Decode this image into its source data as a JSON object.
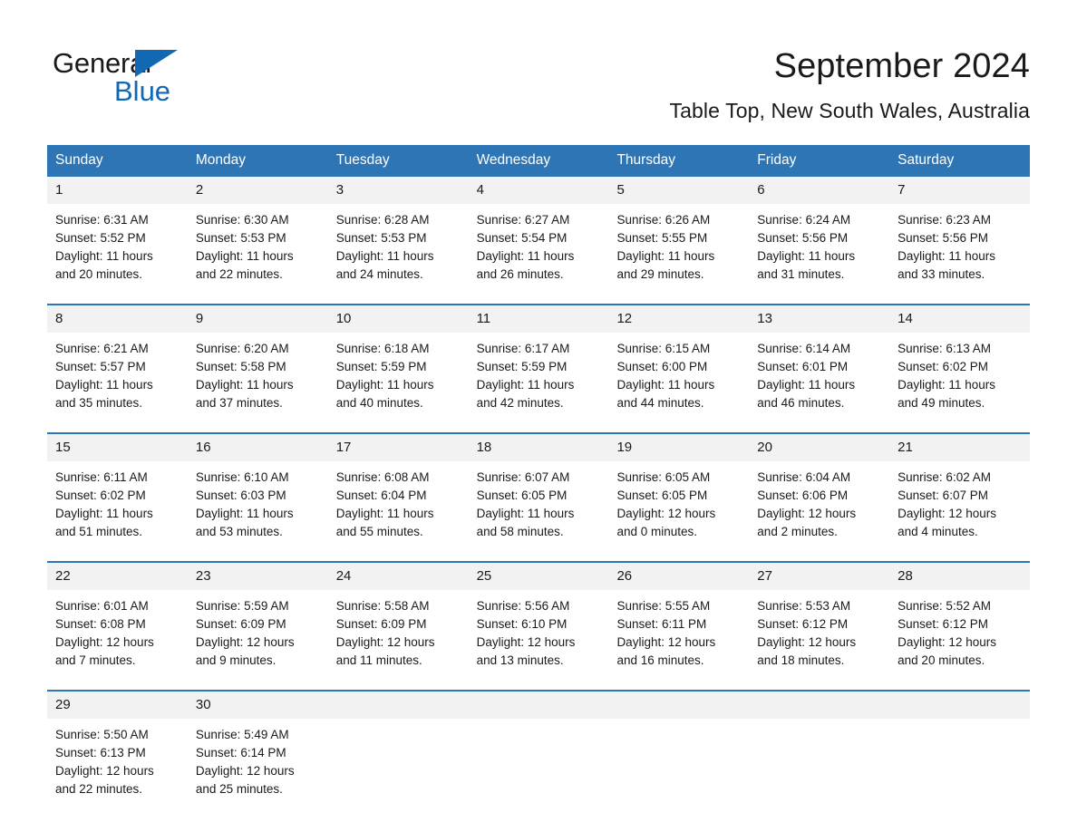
{
  "brand": {
    "name_part1": "General",
    "name_part2": "Blue",
    "accent_color": "#1268b3"
  },
  "header": {
    "month_title": "September 2024",
    "location": "Table Top, New South Wales, Australia"
  },
  "theme": {
    "header_blue": "#2e75b6",
    "date_band": "#f2f2f2",
    "text": "#1a1a1a"
  },
  "weekday_headers": [
    "Sunday",
    "Monday",
    "Tuesday",
    "Wednesday",
    "Thursday",
    "Friday",
    "Saturday"
  ],
  "weeks": [
    [
      {
        "date": "1",
        "sunrise": "Sunrise: 6:31 AM",
        "sunset": "Sunset: 5:52 PM",
        "daylight_line1": "Daylight: 11 hours",
        "daylight_line2": "and 20 minutes."
      },
      {
        "date": "2",
        "sunrise": "Sunrise: 6:30 AM",
        "sunset": "Sunset: 5:53 PM",
        "daylight_line1": "Daylight: 11 hours",
        "daylight_line2": "and 22 minutes."
      },
      {
        "date": "3",
        "sunrise": "Sunrise: 6:28 AM",
        "sunset": "Sunset: 5:53 PM",
        "daylight_line1": "Daylight: 11 hours",
        "daylight_line2": "and 24 minutes."
      },
      {
        "date": "4",
        "sunrise": "Sunrise: 6:27 AM",
        "sunset": "Sunset: 5:54 PM",
        "daylight_line1": "Daylight: 11 hours",
        "daylight_line2": "and 26 minutes."
      },
      {
        "date": "5",
        "sunrise": "Sunrise: 6:26 AM",
        "sunset": "Sunset: 5:55 PM",
        "daylight_line1": "Daylight: 11 hours",
        "daylight_line2": "and 29 minutes."
      },
      {
        "date": "6",
        "sunrise": "Sunrise: 6:24 AM",
        "sunset": "Sunset: 5:56 PM",
        "daylight_line1": "Daylight: 11 hours",
        "daylight_line2": "and 31 minutes."
      },
      {
        "date": "7",
        "sunrise": "Sunrise: 6:23 AM",
        "sunset": "Sunset: 5:56 PM",
        "daylight_line1": "Daylight: 11 hours",
        "daylight_line2": "and 33 minutes."
      }
    ],
    [
      {
        "date": "8",
        "sunrise": "Sunrise: 6:21 AM",
        "sunset": "Sunset: 5:57 PM",
        "daylight_line1": "Daylight: 11 hours",
        "daylight_line2": "and 35 minutes."
      },
      {
        "date": "9",
        "sunrise": "Sunrise: 6:20 AM",
        "sunset": "Sunset: 5:58 PM",
        "daylight_line1": "Daylight: 11 hours",
        "daylight_line2": "and 37 minutes."
      },
      {
        "date": "10",
        "sunrise": "Sunrise: 6:18 AM",
        "sunset": "Sunset: 5:59 PM",
        "daylight_line1": "Daylight: 11 hours",
        "daylight_line2": "and 40 minutes."
      },
      {
        "date": "11",
        "sunrise": "Sunrise: 6:17 AM",
        "sunset": "Sunset: 5:59 PM",
        "daylight_line1": "Daylight: 11 hours",
        "daylight_line2": "and 42 minutes."
      },
      {
        "date": "12",
        "sunrise": "Sunrise: 6:15 AM",
        "sunset": "Sunset: 6:00 PM",
        "daylight_line1": "Daylight: 11 hours",
        "daylight_line2": "and 44 minutes."
      },
      {
        "date": "13",
        "sunrise": "Sunrise: 6:14 AM",
        "sunset": "Sunset: 6:01 PM",
        "daylight_line1": "Daylight: 11 hours",
        "daylight_line2": "and 46 minutes."
      },
      {
        "date": "14",
        "sunrise": "Sunrise: 6:13 AM",
        "sunset": "Sunset: 6:02 PM",
        "daylight_line1": "Daylight: 11 hours",
        "daylight_line2": "and 49 minutes."
      }
    ],
    [
      {
        "date": "15",
        "sunrise": "Sunrise: 6:11 AM",
        "sunset": "Sunset: 6:02 PM",
        "daylight_line1": "Daylight: 11 hours",
        "daylight_line2": "and 51 minutes."
      },
      {
        "date": "16",
        "sunrise": "Sunrise: 6:10 AM",
        "sunset": "Sunset: 6:03 PM",
        "daylight_line1": "Daylight: 11 hours",
        "daylight_line2": "and 53 minutes."
      },
      {
        "date": "17",
        "sunrise": "Sunrise: 6:08 AM",
        "sunset": "Sunset: 6:04 PM",
        "daylight_line1": "Daylight: 11 hours",
        "daylight_line2": "and 55 minutes."
      },
      {
        "date": "18",
        "sunrise": "Sunrise: 6:07 AM",
        "sunset": "Sunset: 6:05 PM",
        "daylight_line1": "Daylight: 11 hours",
        "daylight_line2": "and 58 minutes."
      },
      {
        "date": "19",
        "sunrise": "Sunrise: 6:05 AM",
        "sunset": "Sunset: 6:05 PM",
        "daylight_line1": "Daylight: 12 hours",
        "daylight_line2": "and 0 minutes."
      },
      {
        "date": "20",
        "sunrise": "Sunrise: 6:04 AM",
        "sunset": "Sunset: 6:06 PM",
        "daylight_line1": "Daylight: 12 hours",
        "daylight_line2": "and 2 minutes."
      },
      {
        "date": "21",
        "sunrise": "Sunrise: 6:02 AM",
        "sunset": "Sunset: 6:07 PM",
        "daylight_line1": "Daylight: 12 hours",
        "daylight_line2": "and 4 minutes."
      }
    ],
    [
      {
        "date": "22",
        "sunrise": "Sunrise: 6:01 AM",
        "sunset": "Sunset: 6:08 PM",
        "daylight_line1": "Daylight: 12 hours",
        "daylight_line2": "and 7 minutes."
      },
      {
        "date": "23",
        "sunrise": "Sunrise: 5:59 AM",
        "sunset": "Sunset: 6:09 PM",
        "daylight_line1": "Daylight: 12 hours",
        "daylight_line2": "and 9 minutes."
      },
      {
        "date": "24",
        "sunrise": "Sunrise: 5:58 AM",
        "sunset": "Sunset: 6:09 PM",
        "daylight_line1": "Daylight: 12 hours",
        "daylight_line2": "and 11 minutes."
      },
      {
        "date": "25",
        "sunrise": "Sunrise: 5:56 AM",
        "sunset": "Sunset: 6:10 PM",
        "daylight_line1": "Daylight: 12 hours",
        "daylight_line2": "and 13 minutes."
      },
      {
        "date": "26",
        "sunrise": "Sunrise: 5:55 AM",
        "sunset": "Sunset: 6:11 PM",
        "daylight_line1": "Daylight: 12 hours",
        "daylight_line2": "and 16 minutes."
      },
      {
        "date": "27",
        "sunrise": "Sunrise: 5:53 AM",
        "sunset": "Sunset: 6:12 PM",
        "daylight_line1": "Daylight: 12 hours",
        "daylight_line2": "and 18 minutes."
      },
      {
        "date": "28",
        "sunrise": "Sunrise: 5:52 AM",
        "sunset": "Sunset: 6:12 PM",
        "daylight_line1": "Daylight: 12 hours",
        "daylight_line2": "and 20 minutes."
      }
    ],
    [
      {
        "date": "29",
        "sunrise": "Sunrise: 5:50 AM",
        "sunset": "Sunset: 6:13 PM",
        "daylight_line1": "Daylight: 12 hours",
        "daylight_line2": "and 22 minutes."
      },
      {
        "date": "30",
        "sunrise": "Sunrise: 5:49 AM",
        "sunset": "Sunset: 6:14 PM",
        "daylight_line1": "Daylight: 12 hours",
        "daylight_line2": "and 25 minutes."
      },
      {
        "date": "",
        "sunrise": "",
        "sunset": "",
        "daylight_line1": "",
        "daylight_line2": ""
      },
      {
        "date": "",
        "sunrise": "",
        "sunset": "",
        "daylight_line1": "",
        "daylight_line2": ""
      },
      {
        "date": "",
        "sunrise": "",
        "sunset": "",
        "daylight_line1": "",
        "daylight_line2": ""
      },
      {
        "date": "",
        "sunrise": "",
        "sunset": "",
        "daylight_line1": "",
        "daylight_line2": ""
      },
      {
        "date": "",
        "sunrise": "",
        "sunset": "",
        "daylight_line1": "",
        "daylight_line2": ""
      }
    ]
  ]
}
